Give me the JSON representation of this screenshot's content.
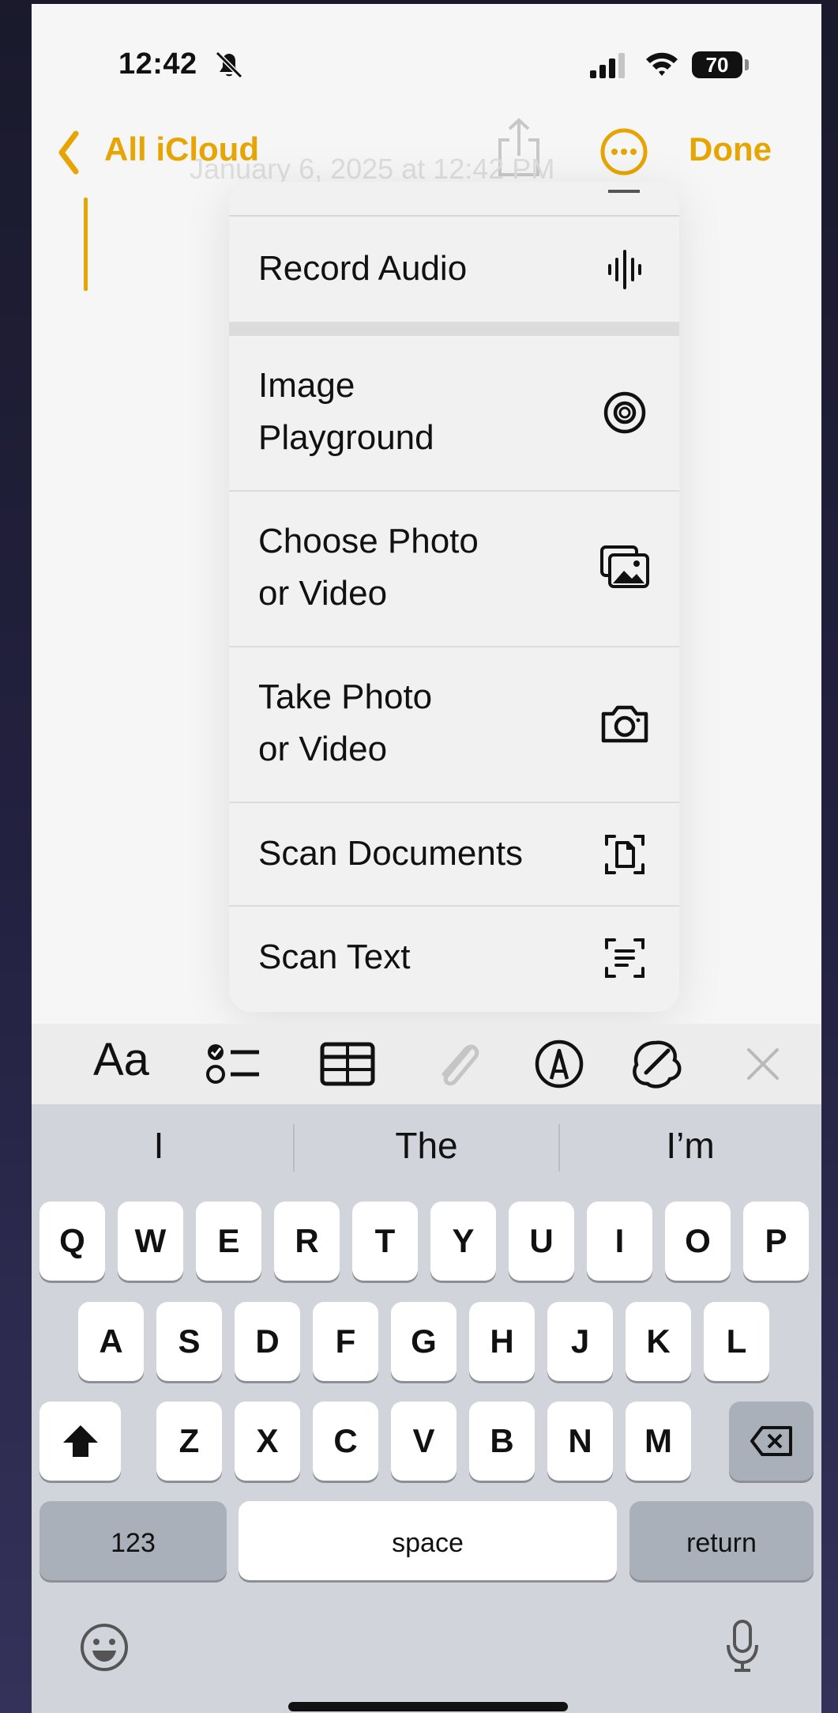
{
  "status_bar": {
    "time": "12:42",
    "battery": "70"
  },
  "nav": {
    "back_label": "All iCloud",
    "done_label": "Done",
    "note_date": "January 6, 2025 at 12:42 PM"
  },
  "menu": {
    "items": [
      {
        "label": "Record Audio",
        "icon": "waveform-icon"
      },
      {
        "label": "Image\nPlayground",
        "icon": "image-playground-icon"
      },
      {
        "label": "Choose Photo\nor Video",
        "icon": "photo-library-icon"
      },
      {
        "label": "Take Photo\nor Video",
        "icon": "camera-icon"
      },
      {
        "label": "Scan Documents",
        "icon": "scan-document-icon"
      },
      {
        "label": "Scan Text",
        "icon": "scan-text-icon"
      }
    ]
  },
  "toolbar": {
    "format_label": "Aa",
    "icons": [
      "checklist-icon",
      "table-icon",
      "attachment-icon",
      "markup-icon",
      "writing-tools-icon",
      "close-icon"
    ]
  },
  "keyboard": {
    "suggestions": [
      "I",
      "The",
      "I’m"
    ],
    "row1": [
      "Q",
      "W",
      "E",
      "R",
      "T",
      "Y",
      "U",
      "I",
      "O",
      "P"
    ],
    "row2": [
      "A",
      "S",
      "D",
      "F",
      "G",
      "H",
      "J",
      "K",
      "L"
    ],
    "row3": [
      "Z",
      "X",
      "C",
      "V",
      "B",
      "N",
      "M"
    ],
    "numbers_label": "123",
    "space_label": "space",
    "return_label": "return"
  },
  "colors": {
    "accent": "#e6a503",
    "keyboard_bg": "#d1d4db",
    "menu_bg": "#f1f1f1"
  }
}
